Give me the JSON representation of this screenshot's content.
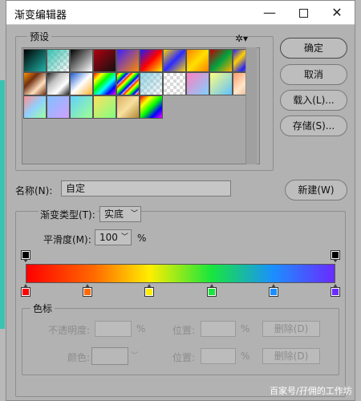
{
  "window": {
    "title": "渐变编辑器"
  },
  "presets": {
    "legend": "预设",
    "swatches": [
      "linear-gradient(135deg,#000 0%,#1fb3a8 100%)",
      "checker:linear-gradient(135deg,#38c0b0,rgba(56,192,176,0))",
      "linear-gradient(135deg,#000,#fff)",
      "linear-gradient(135deg,#b0000f,#111)",
      "linear-gradient(135deg,#3b1fff,#ff8a00)",
      "linear-gradient(135deg,#1a1aff,#ff0000,#ffee00)",
      "linear-gradient(135deg,#ffd400,#2a2aff,#ffd400)",
      "linear-gradient(135deg,#ff8000,#ffe000,#ff8000)",
      "linear-gradient(135deg,#c00000,#00a040,#ffb000)",
      "linear-gradient(135deg,#2020ff,#ffd000,#2020ff,#ffd000)",
      "linear-gradient(135deg,#ff9000,#703010,#ffe0c0,#703010)",
      "linear-gradient(135deg,#202020,#c0c0c0,#ffffff,#202020)",
      "linear-gradient(135deg,#1a5ad0,#ffffff,#ffb030)",
      "linear-gradient(135deg,#ff0000,#ff0,#0f0,#0ff,#00f,#f0f)",
      "checker:repeating-linear-gradient(135deg,#ff0000 0,#ff0 3px,#0f0 6px,#00f 9px,rgba(255,255,255,0) 12px)",
      "checker:linear-gradient(135deg,rgba(120,200,220,0.8),rgba(255,255,255,0))",
      "checker:linear-gradient(135deg,rgba(255,255,255,0),rgba(255,255,255,0))",
      "linear-gradient(135deg,#ff80c0,#80d0ff)",
      "linear-gradient(135deg,#ffff80,#60c0ff)",
      "linear-gradient(135deg,#ff9a6a,#ffe6c8,#d8a080)",
      "linear-gradient(135deg,#ff9090,#90d0ff,#a0ffa0)",
      "linear-gradient(135deg,#80c0ff,#d0a0ff)",
      "linear-gradient(135deg,#60d0ff,#a0ff90)",
      "linear-gradient(135deg,#ffe060,#80ff80)",
      "linear-gradient(135deg,#d8b060,#f8e0a0,#b08830)",
      "linear-gradient(135deg,#ff0000,#ff0,#0f0,#00f,#f0f)"
    ]
  },
  "buttons": {
    "ok": "确定",
    "cancel": "取消",
    "load": "载入(L)...",
    "save": "存储(S)...",
    "new": "新建(W)"
  },
  "name": {
    "label": "名称(N):",
    "value": "自定"
  },
  "gradient": {
    "type_label": "渐变类型(T):",
    "type_value": "实底",
    "smoothness_label": "平滑度(M):",
    "smoothness_value": "100",
    "smoothness_unit": "%",
    "opacity_stops": [
      0.0,
      1.0
    ],
    "color_stops": [
      {
        "position": 0.0,
        "color": "#ff0000"
      },
      {
        "position": 0.2,
        "color": "#ff6a00"
      },
      {
        "position": 0.4,
        "color": "#ffee00"
      },
      {
        "position": 0.6,
        "color": "#17e63c"
      },
      {
        "position": 0.8,
        "color": "#1b8fff"
      },
      {
        "position": 1.0,
        "color": "#6a2bff"
      }
    ]
  },
  "stops_panel": {
    "legend": "色标",
    "opacity_label": "不透明度:",
    "opacity_unit": "%",
    "location_label": "位置:",
    "location_unit": "%",
    "delete_label": "删除(D)",
    "color_label": "颜色:"
  },
  "watermark": "百家号/孖佣的工作坊"
}
